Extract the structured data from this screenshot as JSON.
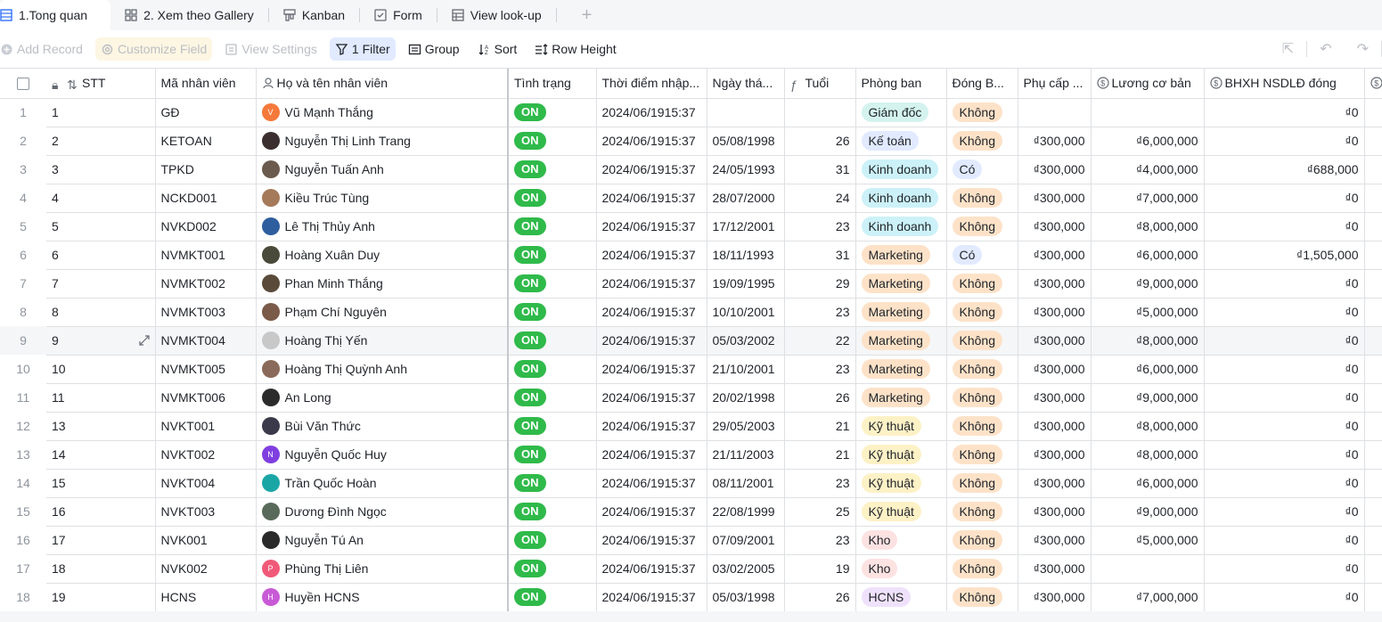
{
  "tabs": [
    {
      "label": "1.Tong quan",
      "icon": "grid-view-icon",
      "active": true
    },
    {
      "label": "2. Xem theo Gallery",
      "icon": "gallery-view-icon"
    },
    {
      "label": "Kanban",
      "icon": "kanban-view-icon"
    },
    {
      "label": "Form",
      "icon": "form-view-icon"
    },
    {
      "label": "View look-up",
      "icon": "grid-view-icon"
    }
  ],
  "toolbar": {
    "add_record": "Add Record",
    "customize_field": "Customize Field",
    "view_settings": "View Settings",
    "filter": "1 Filter",
    "group": "Group",
    "sort": "Sort",
    "row_height": "Row Height"
  },
  "columns": {
    "stt": "STT",
    "ma_nv": "Mã nhân viên",
    "ho_ten": "Họ và tên nhân viên",
    "tinh_trang": "Tình trạng",
    "thoi_diem": "Thời điểm nhập...",
    "ngay_thang": "Ngày thá...",
    "tuoi": "Tuổi",
    "phong_ban": "Phòng ban",
    "dong_bh": "Đóng B...",
    "phu_cap": "Phụ cấp ...",
    "luong": "Lương cơ bản",
    "bhxh": "BHXH NSDLĐ đóng"
  },
  "colors": {
    "on": "#2fba4a",
    "accent": "#3370ff",
    "dept": {
      "Giám đốc": "#d4f3ef",
      "Kế toán": "#e1eaff",
      "Kinh doanh": "#ccf1f8",
      "Marketing": "#fde2c8",
      "Kỹ thuật": "#fdf1c6",
      "Kho": "#fde2e2",
      "HCNS": "#efe1fb"
    },
    "bh": {
      "Không": "#fde2c8",
      "Có": "#e1eaff"
    }
  },
  "rows": [
    {
      "n": "1",
      "stt": "1",
      "ma": "GĐ",
      "name": "Vũ Mạnh Thắng",
      "av": "V",
      "avc": "#f5793a",
      "status": "ON",
      "td": "2024/06/1915:37",
      "dob": "",
      "age": "",
      "dept": "Giám đốc",
      "bh": "Không",
      "pc": "",
      "luong": "",
      "bhxh": "₫0"
    },
    {
      "n": "2",
      "stt": "2",
      "ma": "KETOAN",
      "name": "Nguyễn Thị Linh Trang",
      "av": "",
      "avc": "#3b2f2f",
      "status": "ON",
      "td": "2024/06/1915:37",
      "dob": "05/08/1998",
      "age": "26",
      "dept": "Kế toán",
      "bh": "Không",
      "pc": "₫300,000",
      "luong": "₫6,000,000",
      "bhxh": "₫0"
    },
    {
      "n": "3",
      "stt": "3",
      "ma": "TPKD",
      "name": "Nguyễn Tuấn Anh",
      "av": "",
      "avc": "#6b5a4e",
      "status": "ON",
      "td": "2024/06/1915:37",
      "dob": "24/05/1993",
      "age": "31",
      "dept": "Kinh doanh",
      "bh": "Có",
      "pc": "₫300,000",
      "luong": "₫4,000,000",
      "bhxh": "₫688,000"
    },
    {
      "n": "4",
      "stt": "4",
      "ma": "NCKD001",
      "name": "Kiều Trúc Tùng",
      "av": "",
      "avc": "#a57a5a",
      "status": "ON",
      "td": "2024/06/1915:37",
      "dob": "28/07/2000",
      "age": "24",
      "dept": "Kinh doanh",
      "bh": "Không",
      "pc": "₫300,000",
      "luong": "₫7,000,000",
      "bhxh": "₫0"
    },
    {
      "n": "5",
      "stt": "5",
      "ma": "NVKD002",
      "name": "Lê Thị Thủy Anh",
      "av": "",
      "avc": "#2e5e9e",
      "status": "ON",
      "td": "2024/06/1915:37",
      "dob": "17/12/2001",
      "age": "23",
      "dept": "Kinh doanh",
      "bh": "Không",
      "pc": "₫300,000",
      "luong": "₫8,000,000",
      "bhxh": "₫0"
    },
    {
      "n": "6",
      "stt": "6",
      "ma": "NVMKT001",
      "name": "Hoàng Xuân Duy",
      "av": "",
      "avc": "#4a4a3a",
      "status": "ON",
      "td": "2024/06/1915:37",
      "dob": "18/11/1993",
      "age": "31",
      "dept": "Marketing",
      "bh": "Có",
      "pc": "₫300,000",
      "luong": "₫6,000,000",
      "bhxh": "₫1,505,000"
    },
    {
      "n": "7",
      "stt": "7",
      "ma": "NVMKT002",
      "name": "Phan Minh Thắng",
      "av": "",
      "avc": "#5a4a3a",
      "status": "ON",
      "td": "2024/06/1915:37",
      "dob": "19/09/1995",
      "age": "29",
      "dept": "Marketing",
      "bh": "Không",
      "pc": "₫300,000",
      "luong": "₫9,000,000",
      "bhxh": "₫0"
    },
    {
      "n": "8",
      "stt": "8",
      "ma": "NVMKT003",
      "name": "Phạm Chí Nguyên",
      "av": "",
      "avc": "#7a5a48",
      "status": "ON",
      "td": "2024/06/1915:37",
      "dob": "10/10/2001",
      "age": "23",
      "dept": "Marketing",
      "bh": "Không",
      "pc": "₫300,000",
      "luong": "₫5,000,000",
      "bhxh": "₫0"
    },
    {
      "n": "9",
      "stt": "9",
      "ma": "NVMKT004",
      "name": "Hoàng Thị Yến",
      "av": "",
      "avc": "#c8c8c8",
      "status": "ON",
      "td": "2024/06/1915:37",
      "dob": "05/03/2002",
      "age": "22",
      "dept": "Marketing",
      "bh": "Không",
      "pc": "₫300,000",
      "luong": "₫8,000,000",
      "bhxh": "₫0",
      "hover": true
    },
    {
      "n": "10",
      "stt": "10",
      "ma": "NVMKT005",
      "name": "Hoàng Thị Quỳnh Anh",
      "av": "",
      "avc": "#8a6a5a",
      "status": "ON",
      "td": "2024/06/1915:37",
      "dob": "21/10/2001",
      "age": "23",
      "dept": "Marketing",
      "bh": "Không",
      "pc": "₫300,000",
      "luong": "₫6,000,000",
      "bhxh": "₫0"
    },
    {
      "n": "11",
      "stt": "11",
      "ma": "NVMKT006",
      "name": "An Long",
      "av": "",
      "avc": "#2b2b2b",
      "status": "ON",
      "td": "2024/06/1915:37",
      "dob": "20/02/1998",
      "age": "26",
      "dept": "Marketing",
      "bh": "Không",
      "pc": "₫300,000",
      "luong": "₫9,000,000",
      "bhxh": "₫0"
    },
    {
      "n": "12",
      "stt": "13",
      "ma": "NVKT001",
      "name": "Bùi Văn Thức",
      "av": "",
      "avc": "#3a3a4a",
      "status": "ON",
      "td": "2024/06/1915:37",
      "dob": "29/05/2003",
      "age": "21",
      "dept": "Kỹ thuật",
      "bh": "Không",
      "pc": "₫300,000",
      "luong": "₫8,000,000",
      "bhxh": "₫0"
    },
    {
      "n": "13",
      "stt": "14",
      "ma": "NVKT002",
      "name": "Nguyễn Quốc Huy",
      "av": "N",
      "avc": "#7f3fe0",
      "status": "ON",
      "td": "2024/06/1915:37",
      "dob": "21/11/2003",
      "age": "21",
      "dept": "Kỹ thuật",
      "bh": "Không",
      "pc": "₫300,000",
      "luong": "₫8,000,000",
      "bhxh": "₫0"
    },
    {
      "n": "14",
      "stt": "15",
      "ma": "NVKT004",
      "name": "Trần Quốc Hoàn",
      "av": "",
      "avc": "#1ba6a6",
      "status": "ON",
      "td": "2024/06/1915:37",
      "dob": "08/11/2001",
      "age": "23",
      "dept": "Kỹ thuật",
      "bh": "Không",
      "pc": "₫300,000",
      "luong": "₫6,000,000",
      "bhxh": "₫0"
    },
    {
      "n": "15",
      "stt": "16",
      "ma": "NVKT003",
      "name": "Dương Đình Ngọc",
      "av": "",
      "avc": "#5a6a5a",
      "status": "ON",
      "td": "2024/06/1915:37",
      "dob": "22/08/1999",
      "age": "25",
      "dept": "Kỹ thuật",
      "bh": "Không",
      "pc": "₫300,000",
      "luong": "₫9,000,000",
      "bhxh": "₫0"
    },
    {
      "n": "16",
      "stt": "17",
      "ma": "NVK001",
      "name": "Nguyễn Tú An",
      "av": "",
      "avc": "#2a2a2a",
      "status": "ON",
      "td": "2024/06/1915:37",
      "dob": "07/09/2001",
      "age": "23",
      "dept": "Kho",
      "bh": "Không",
      "pc": "₫300,000",
      "luong": "₫5,000,000",
      "bhxh": "₫0"
    },
    {
      "n": "17",
      "stt": "18",
      "ma": "NVK002",
      "name": "Phùng Thị Liên",
      "av": "P",
      "avc": "#f05a78",
      "status": "ON",
      "td": "2024/06/1915:37",
      "dob": "03/02/2005",
      "age": "19",
      "dept": "Kho",
      "bh": "Không",
      "pc": "₫300,000",
      "luong": "",
      "bhxh": "₫0"
    },
    {
      "n": "18",
      "stt": "19",
      "ma": "HCNS",
      "name": "Huyền HCNS",
      "av": "H",
      "avc": "#c85ad6",
      "status": "ON",
      "td": "2024/06/1915:37",
      "dob": "05/03/1998",
      "age": "26",
      "dept": "HCNS",
      "bh": "Không",
      "pc": "₫300,000",
      "luong": "₫7,000,000",
      "bhxh": "₫0"
    }
  ]
}
